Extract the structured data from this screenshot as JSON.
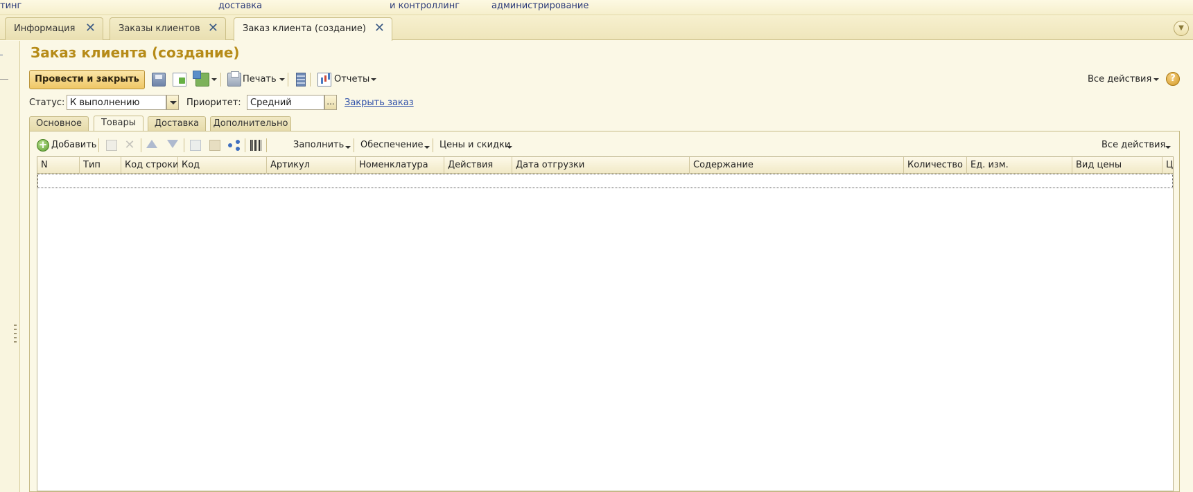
{
  "section_menu": {
    "items": [
      "тинг",
      "доставка",
      "и контроллинг",
      "администрирование"
    ]
  },
  "window_tabs": [
    {
      "label": "Информация"
    },
    {
      "label": "Заказы клиентов"
    },
    {
      "label": "Заказ клиента (создание)",
      "active": true
    }
  ],
  "icons": {
    "tab_close": "close-icon",
    "tabs_menu": "chevron-down-icon",
    "help": "help-icon"
  },
  "page": {
    "title": "Заказ клиента (создание)"
  },
  "command_bar": {
    "post_and_close": "Провести и закрыть",
    "print": "Печать",
    "reports": "Отчеты",
    "all_actions": "Все действия",
    "help": "?"
  },
  "status_row": {
    "status_label": "Статус:",
    "status_value": "К выполнению",
    "priority_label": "Приоритет:",
    "priority_value": "Средний",
    "priority_select": "...",
    "close_order_link": "Закрыть заказ"
  },
  "form_tabs": [
    {
      "label": "Основное"
    },
    {
      "label": "Товары",
      "active": true
    },
    {
      "label": "Доставка"
    },
    {
      "label": "Дополнительно"
    }
  ],
  "items_toolbar": {
    "add": "Добавить",
    "add_sign": "+",
    "delete_sign": "✕",
    "fill": "Заполнить",
    "provision": "Обеспечение",
    "prices_discounts": "Цены и скидки",
    "all_actions": "Все действия"
  },
  "grid": {
    "columns": [
      "N",
      "Тип",
      "Код строки",
      "Код",
      "Артикул",
      "Номенклатура",
      "Действия",
      "Дата отгрузки",
      "Содержание",
      "Количество",
      "Ед. изм.",
      "Вид цены",
      "Ц"
    ],
    "rows": []
  },
  "colors": {
    "title": "#b68b18",
    "link": "#2c4ea8",
    "background": "#fbf8e6"
  }
}
